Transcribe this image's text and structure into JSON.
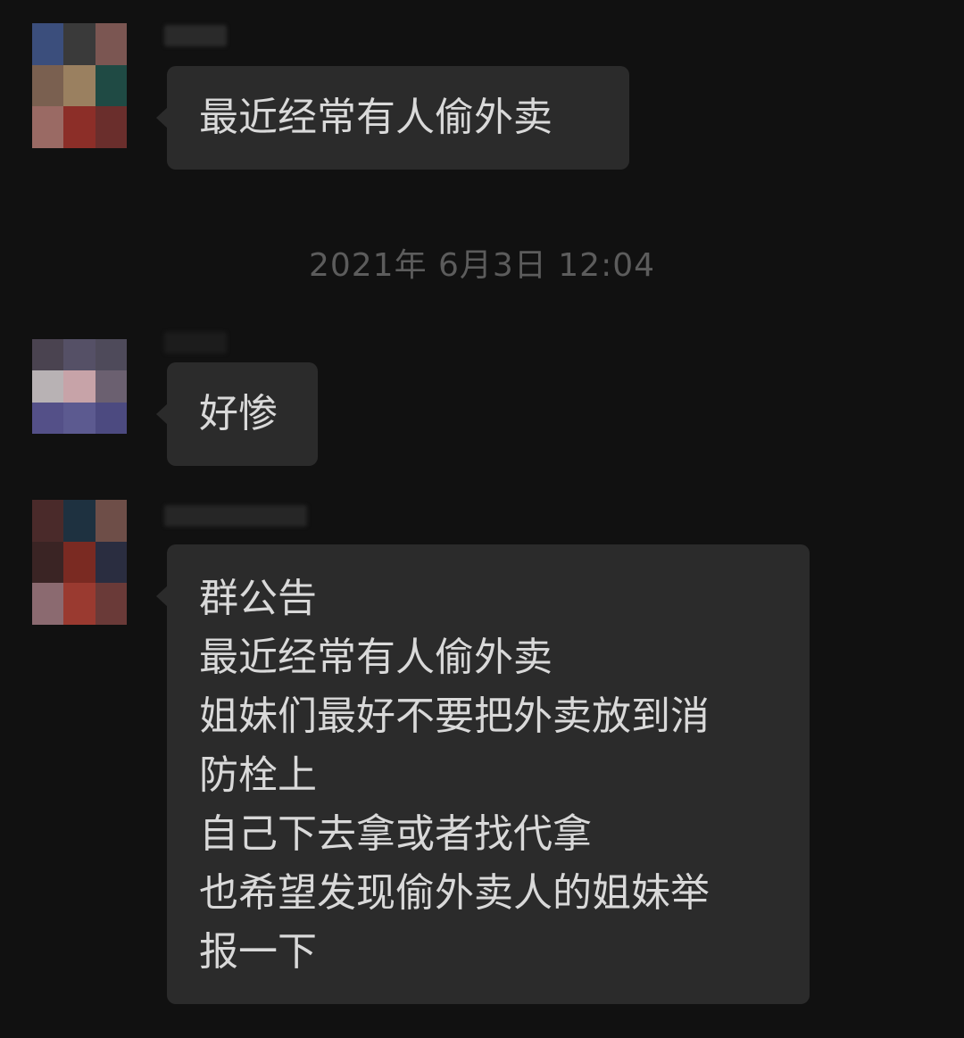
{
  "messages": [
    {
      "sender_avatar_colors": [
        "#3b4e7c",
        "#3a3a3a",
        "#7b5652",
        "#7a6050",
        "#9a8060",
        "#1f4a44",
        "#9a6a64",
        "#8c2e28",
        "#6a2e2c"
      ],
      "lines": [
        "最近经常有人偷外卖"
      ]
    },
    {
      "sender_avatar_colors": [
        "#4a4350",
        "#555066",
        "#4e4a5a",
        "#b8b2b4",
        "#c7a3a8",
        "#6b6070",
        "#545088",
        "#5c5a90",
        "#4c4a80"
      ],
      "lines": [
        "好惨"
      ]
    },
    {
      "sender_avatar_colors": [
        "#4a2a2a",
        "#1e3140",
        "#6e4e48",
        "#3a2424",
        "#7a2a22",
        "#2a2d40",
        "#8b6a70",
        "#9a3a30",
        "#6a3a38"
      ],
      "lines": [
        "群公告",
        "最近经常有人偷外卖",
        "姐妹们最好不要把外卖放到消",
        "防栓上",
        "自己下去拿或者找代拿",
        "也希望发现偷外卖人的姐妹举",
        "报一下"
      ]
    }
  ],
  "timestamp": "2021年 6月3日 12:04",
  "colors": {
    "background": "#111111",
    "bubble": "#2b2b2b",
    "text": "#d9d9d9",
    "timestamp": "#5c5c5c"
  }
}
